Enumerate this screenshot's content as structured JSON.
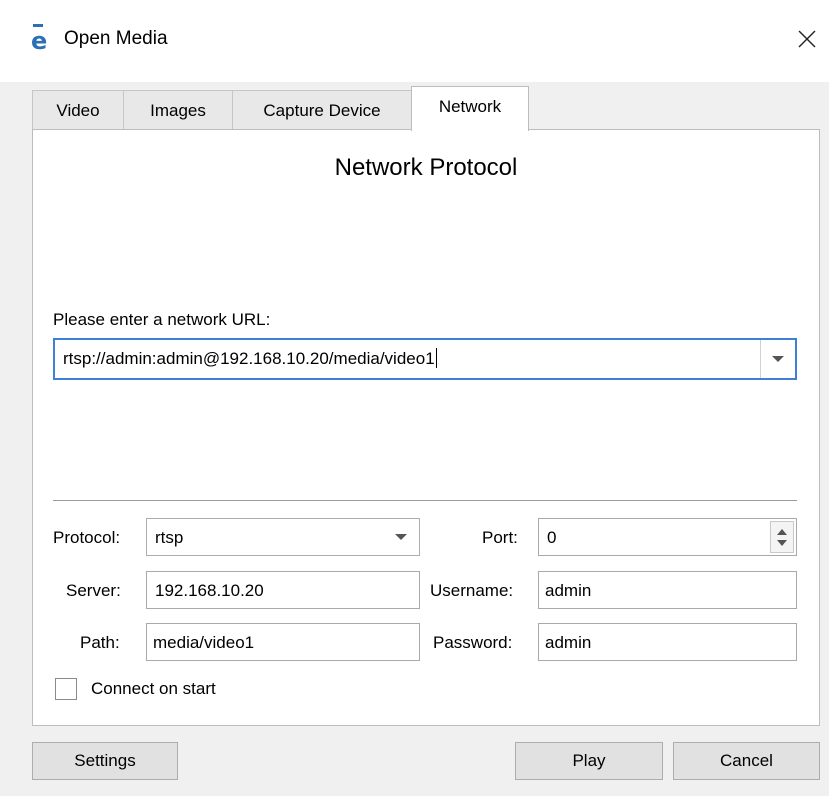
{
  "window": {
    "title": "Open Media",
    "app_icon_glyph": "e",
    "app_icon": "app-logo-icon",
    "close_icon": "close-icon"
  },
  "tabs": [
    {
      "label": "Video",
      "active": false
    },
    {
      "label": "Images",
      "active": false
    },
    {
      "label": "Capture Device",
      "active": false
    },
    {
      "label": "Network",
      "active": true
    }
  ],
  "network": {
    "heading": "Network Protocol",
    "url_label": "Please enter a network URL:",
    "url_value": "rtsp://admin:admin@192.168.10.20/media/video1",
    "protocol_label": "Protocol:",
    "protocol_value": "rtsp",
    "port_label": "Port:",
    "port_value": "0",
    "server_label": "Server:",
    "server_value": "192.168.10.20",
    "username_label": "Username:",
    "username_value": "admin",
    "path_label": "Path:",
    "path_value": "media/video1",
    "password_label": "Password:",
    "password_value": "admin",
    "connect_on_start_label": "Connect on start",
    "connect_on_start_checked": false
  },
  "buttons": {
    "settings": "Settings",
    "play": "Play",
    "cancel": "Cancel"
  },
  "colors": {
    "accent": "#3f7fd8",
    "icon_blue": "#2b6fb6"
  }
}
